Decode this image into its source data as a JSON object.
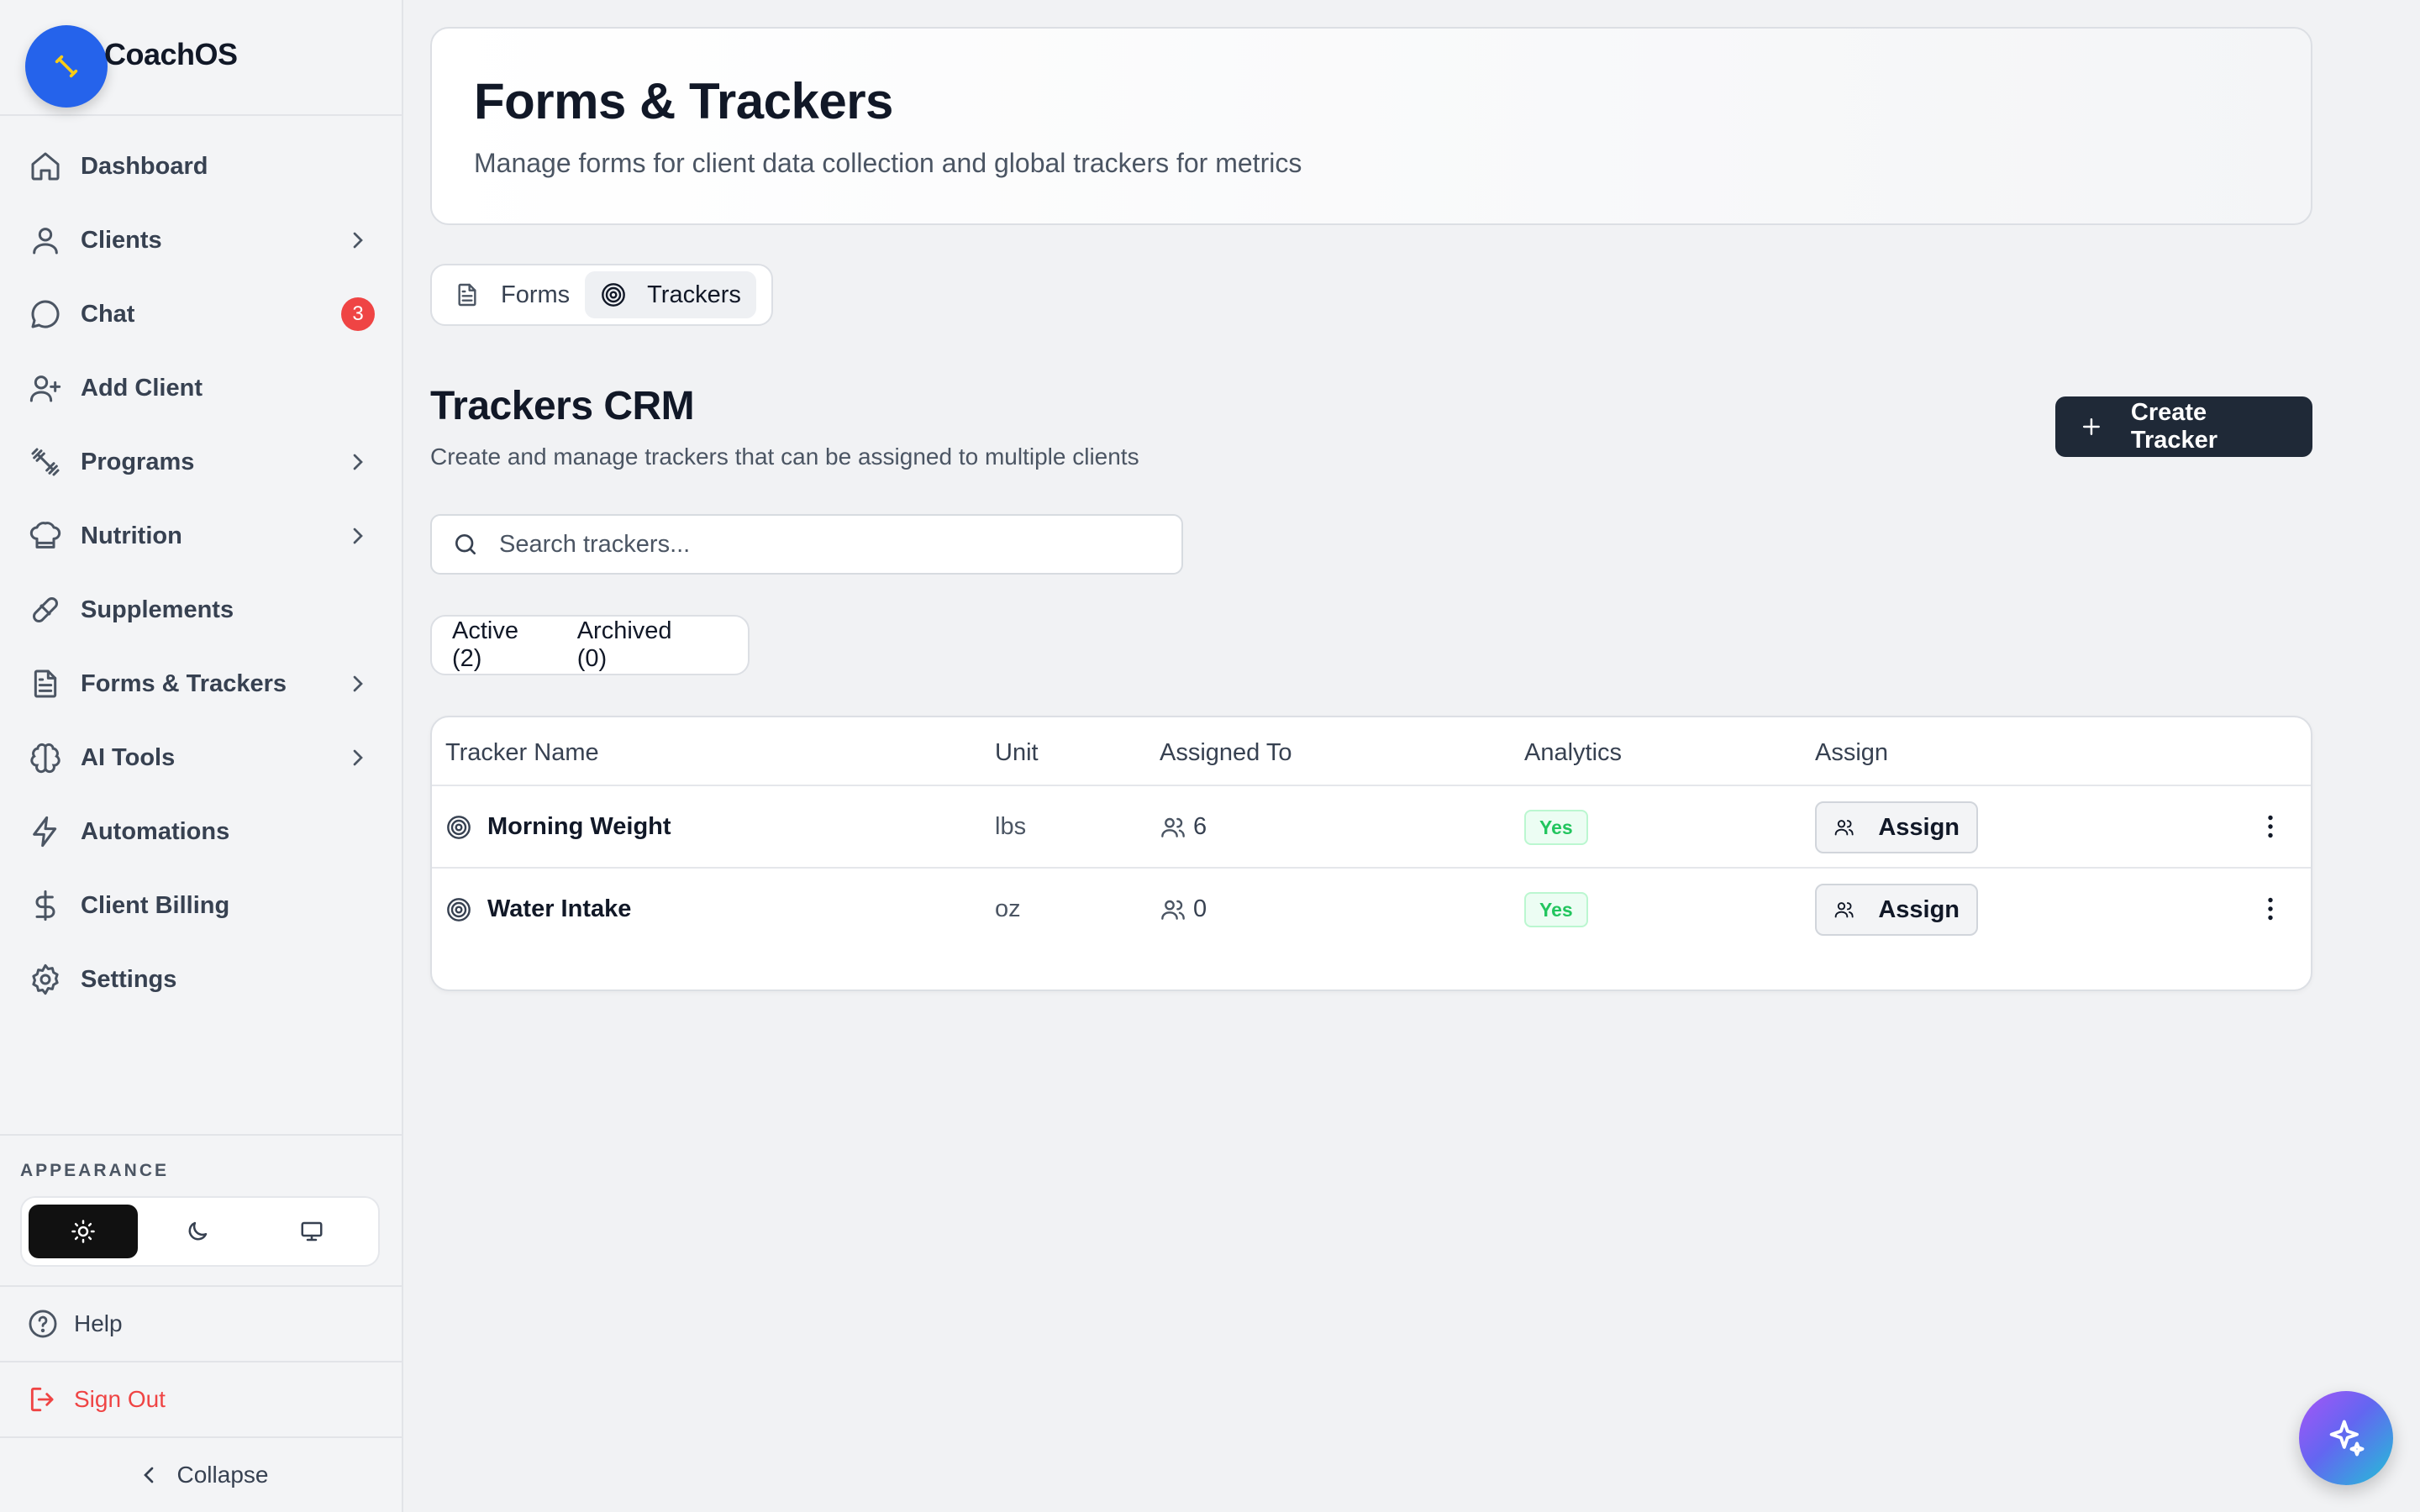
{
  "brand": {
    "name": "CoachOS"
  },
  "sidebar": {
    "items": [
      {
        "label": "Dashboard",
        "icon": "home-icon",
        "chevron": false
      },
      {
        "label": "Clients",
        "icon": "user-icon",
        "chevron": true
      },
      {
        "label": "Chat",
        "icon": "chat-bubble-icon",
        "chevron": false,
        "badge": "3"
      },
      {
        "label": "Add Client",
        "icon": "user-plus-icon",
        "chevron": false
      },
      {
        "label": "Programs",
        "icon": "dumbbell-icon",
        "chevron": true
      },
      {
        "label": "Nutrition",
        "icon": "chef-hat-icon",
        "chevron": true
      },
      {
        "label": "Supplements",
        "icon": "pill-icon",
        "chevron": false
      },
      {
        "label": "Forms & Trackers",
        "icon": "file-text-icon",
        "chevron": true
      },
      {
        "label": "AI Tools",
        "icon": "brain-icon",
        "chevron": true
      },
      {
        "label": "Automations",
        "icon": "lightning-icon",
        "chevron": false
      },
      {
        "label": "Client Billing",
        "icon": "dollar-icon",
        "chevron": false
      },
      {
        "label": "Settings",
        "icon": "gear-icon",
        "chevron": false
      }
    ],
    "appearance": {
      "title": "APPEARANCE",
      "options": [
        "sun-icon",
        "moon-icon",
        "monitor-icon"
      ],
      "active": "sun-icon"
    },
    "help": "Help",
    "sign_out": "Sign Out",
    "collapse": "Collapse"
  },
  "header": {
    "title": "Forms & Trackers",
    "subtitle": "Manage forms for client data collection and global trackers for metrics"
  },
  "tabs": [
    {
      "label": "Forms",
      "icon": "file-text-icon",
      "active": false
    },
    {
      "label": "Trackers",
      "icon": "target-icon",
      "active": true
    }
  ],
  "section": {
    "title": "Trackers CRM",
    "subtitle": "Create and manage trackers that can be assigned to multiple clients",
    "create_label": "Create Tracker"
  },
  "search": {
    "placeholder": "Search trackers...",
    "value": ""
  },
  "filters": {
    "active": "Active (2)",
    "archived": "Archived (0)"
  },
  "table": {
    "headers": [
      "Tracker Name",
      "Unit",
      "Assigned To",
      "Analytics",
      "Assign"
    ],
    "rows": [
      {
        "name": "Morning Weight",
        "unit": "lbs",
        "assigned": "6",
        "analytics": "Yes",
        "assign_label": "Assign"
      },
      {
        "name": "Water Intake",
        "unit": "oz",
        "assigned": "0",
        "analytics": "Yes",
        "assign_label": "Assign"
      }
    ]
  },
  "colors": {
    "brand_blue": "#2563eb",
    "primary_dark": "#1f2937",
    "badge_red": "#ef4444",
    "success_green": "#22c55e",
    "sign_out_red": "#ef4444"
  }
}
